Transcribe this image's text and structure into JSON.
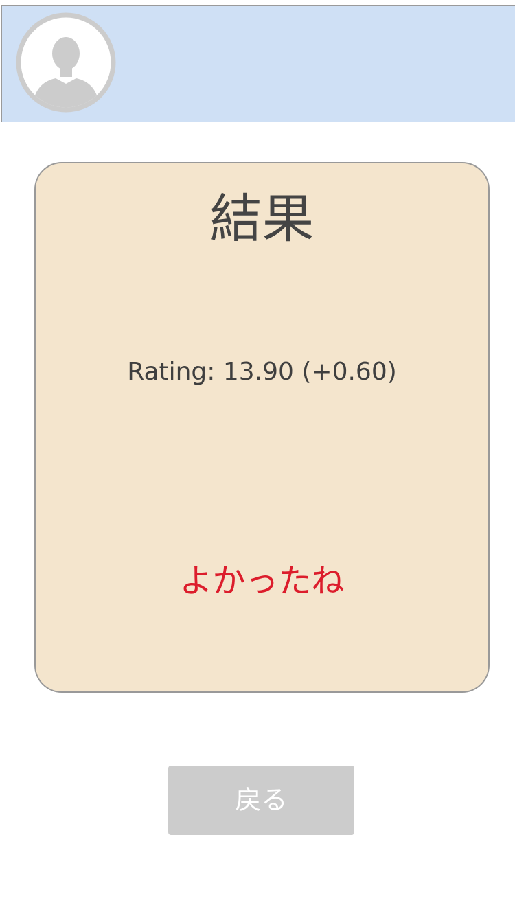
{
  "header": {
    "avatar_icon": "default-user-avatar-icon",
    "background_color": "#cfe0f5"
  },
  "result_card": {
    "title": "結果",
    "rating_text": "Rating: 13.90 (+0.60)",
    "message": "よかったね",
    "background_color": "#f4e5cd",
    "message_color": "#dc1d2c"
  },
  "footer": {
    "back_label": "戻る",
    "button_color": "#cccccc"
  }
}
